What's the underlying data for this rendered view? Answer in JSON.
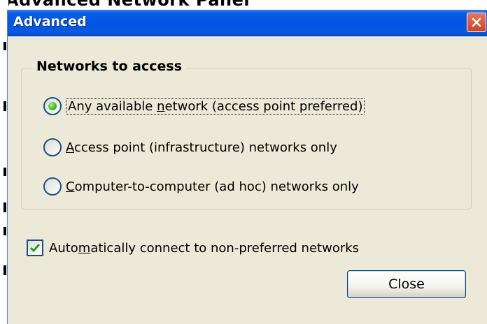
{
  "background_title": "Advanced Network Panel",
  "dialog": {
    "title": "Advanced",
    "close_icon": "close-icon"
  },
  "group": {
    "legend": "Networks to access",
    "options": [
      {
        "pre": "Any available ",
        "key": "n",
        "post": "etwork (access point preferred)",
        "checked": true
      },
      {
        "pre": "",
        "key": "A",
        "post": "ccess point (infrastructure) networks only",
        "checked": false
      },
      {
        "pre": "",
        "key": "C",
        "post": "omputer-to-computer (ad hoc) networks only",
        "checked": false
      }
    ]
  },
  "auto_connect": {
    "pre": "Auto",
    "key": "m",
    "post": "atically connect to non-preferred networks",
    "checked": true
  },
  "close_button": {
    "label": "Close"
  },
  "colors": {
    "titlebar": "#0054e3",
    "dialog_bg": "#ece9d8",
    "radio_selected": "#3fb81b",
    "close_x": "#c9442a"
  }
}
